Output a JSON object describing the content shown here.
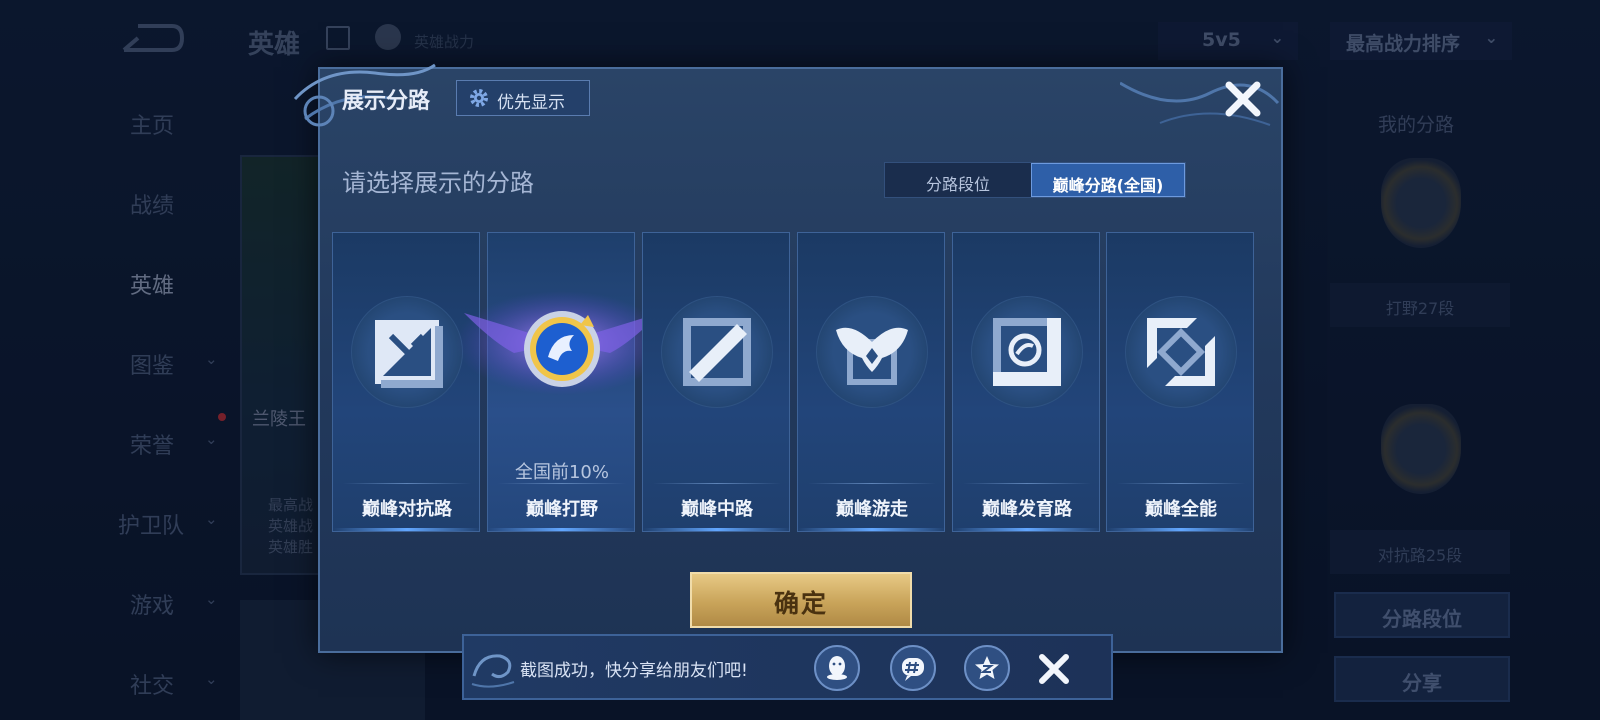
{
  "background": {
    "header": {
      "title": "英雄",
      "power_label": "英雄战力",
      "mode_select": "5v5",
      "sort_select": "最高战力排序"
    },
    "nav": [
      {
        "label": "主页",
        "has_chevron": false,
        "active": false
      },
      {
        "label": "战绩",
        "has_chevron": false,
        "active": false
      },
      {
        "label": "英雄",
        "has_chevron": false,
        "active": true
      },
      {
        "label": "图鉴",
        "has_chevron": true,
        "active": false
      },
      {
        "label": "荣誉",
        "has_chevron": true,
        "active": false
      },
      {
        "label": "护卫队",
        "has_chevron": true,
        "active": false
      },
      {
        "label": "游戏",
        "has_chevron": true,
        "active": false
      },
      {
        "label": "社交",
        "has_chevron": true,
        "active": false
      }
    ],
    "hero_card": {
      "name": "兰陵王",
      "info_lines": [
        "最高战",
        "英雄战",
        "英雄胜"
      ]
    },
    "right_panel": {
      "title": "我的分路",
      "ranks": [
        "打野27段",
        "对抗路25段"
      ],
      "buttons": [
        "分路段位",
        "分享"
      ]
    }
  },
  "dialog": {
    "title": "展示分路",
    "priority_button": "优先显示",
    "subtitle": "请选择展示的分路",
    "segment": {
      "options": [
        "分路段位",
        "巅峰分路(全国)"
      ],
      "selected": "巅峰分路(全国)"
    },
    "lanes": [
      {
        "label": "巅峰对抗路",
        "icon": "sword-lane-icon",
        "ranking": "",
        "selected": false
      },
      {
        "label": "巅峰打野",
        "icon": "jungle-dragon-emblem-icon",
        "ranking": "全国前10%",
        "selected": true
      },
      {
        "label": "巅峰中路",
        "icon": "mid-lane-icon",
        "ranking": "",
        "selected": false
      },
      {
        "label": "巅峰游走",
        "icon": "support-wings-icon",
        "ranking": "",
        "selected": false
      },
      {
        "label": "巅峰发育路",
        "icon": "farm-lane-icon",
        "ranking": "",
        "selected": false
      },
      {
        "label": "巅峰全能",
        "icon": "all-round-icon",
        "ranking": "",
        "selected": false
      }
    ],
    "confirm_button": "确定"
  },
  "toast": {
    "message": "截图成功，快分享给朋友们吧!",
    "share_targets": [
      "qq-icon",
      "moments-icon",
      "qzone-icon"
    ]
  },
  "colors": {
    "accent_blue": "#2e5fa8",
    "confirm_gold": "#c9a45a",
    "dialog_bg": "#22395c"
  }
}
